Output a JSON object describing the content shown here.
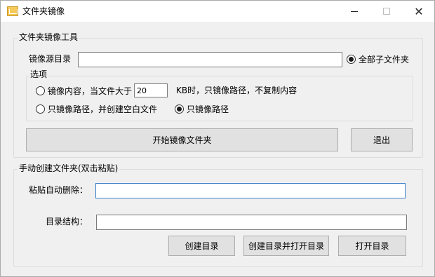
{
  "window": {
    "title": "文件夹镜像",
    "icon": "folder-icon",
    "controls": {
      "minimize": "minimize-icon",
      "maximize": "maximize-icon",
      "close": "✕"
    }
  },
  "mirror_tool": {
    "legend": "文件夹镜像工具",
    "source_dir_label": "镜像源目录",
    "source_dir_value": "",
    "all_subfolders_label": "全部子文件夹",
    "all_subfolders_checked": true,
    "options": {
      "legend": "选项",
      "mirror_content_label": "镜像内容，当文件大于",
      "size_threshold_value": "20",
      "size_suffix_label": "KB时，只镜像路径，不复制内容",
      "path_with_empty_files_label": "只镜像路径，并创建空白文件",
      "path_only_label": "只镜像路径",
      "selected": "path_only"
    },
    "start_button": "开始镜像文件夹",
    "exit_button": "退出"
  },
  "manual_create": {
    "legend": "手动创建文件夹(双击粘贴)",
    "paste_label": "粘贴自动删除：",
    "paste_value": "",
    "structure_label": "目录结构：",
    "structure_value": "",
    "create_button": "创建目录",
    "create_open_button": "创建目录并打开目录",
    "open_button": "打开目录"
  },
  "colors": {
    "window_bg": "#f0f0f0",
    "titlebar_bg": "#ffffff",
    "focus_border": "#3b80c8"
  }
}
